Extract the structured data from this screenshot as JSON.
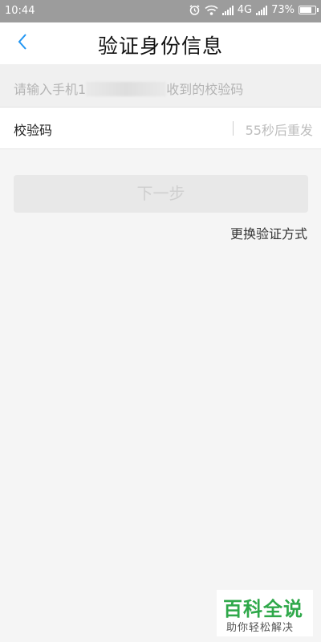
{
  "status_bar": {
    "time": "10:44",
    "network": "4G",
    "battery": "73%",
    "battery_level": 0.73
  },
  "nav": {
    "title": "验证身份信息",
    "back_icon": "chevron-left-icon"
  },
  "hint": {
    "prefix": "请输入手机1",
    "suffix": "收到的校验码"
  },
  "code_field": {
    "label": "校验码",
    "value": "",
    "placeholder": "",
    "resend_text": "55秒后重发"
  },
  "next_button": {
    "label": "下一步"
  },
  "switch_method": {
    "label": "更换验证方式"
  },
  "watermark": {
    "title": "百科全说",
    "subtitle": "助你轻松解决"
  },
  "colors": {
    "accent": "#2196f3",
    "status_bar": "#9c9c9c",
    "watermark_green": "#2fa84a"
  }
}
